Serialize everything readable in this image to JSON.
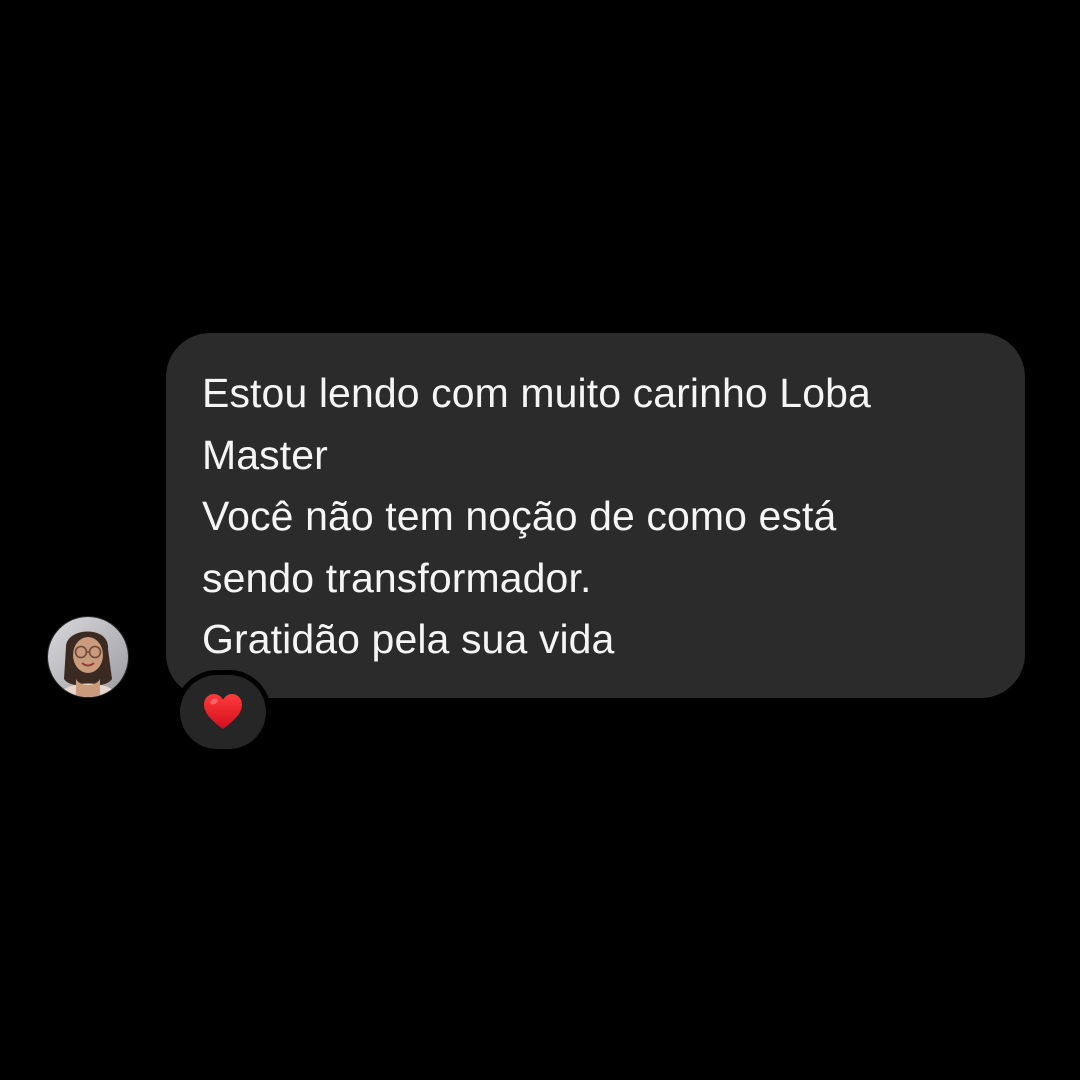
{
  "conversation": {
    "message": {
      "lines": [
        "Estou lendo com muito carinho Loba",
        "Master",
        "Você não tem noção de como está",
        "sendo transformador.",
        "Gratidão pela sua vida"
      ],
      "bubble_color": "#2b2b2b",
      "text_color": "#f5f5f5"
    },
    "sender": {
      "avatar_icon": "user-photo-avatar"
    },
    "reaction": {
      "icon": "red-heart-icon",
      "color": "#e0131f"
    }
  },
  "theme": {
    "background": "#000000"
  }
}
